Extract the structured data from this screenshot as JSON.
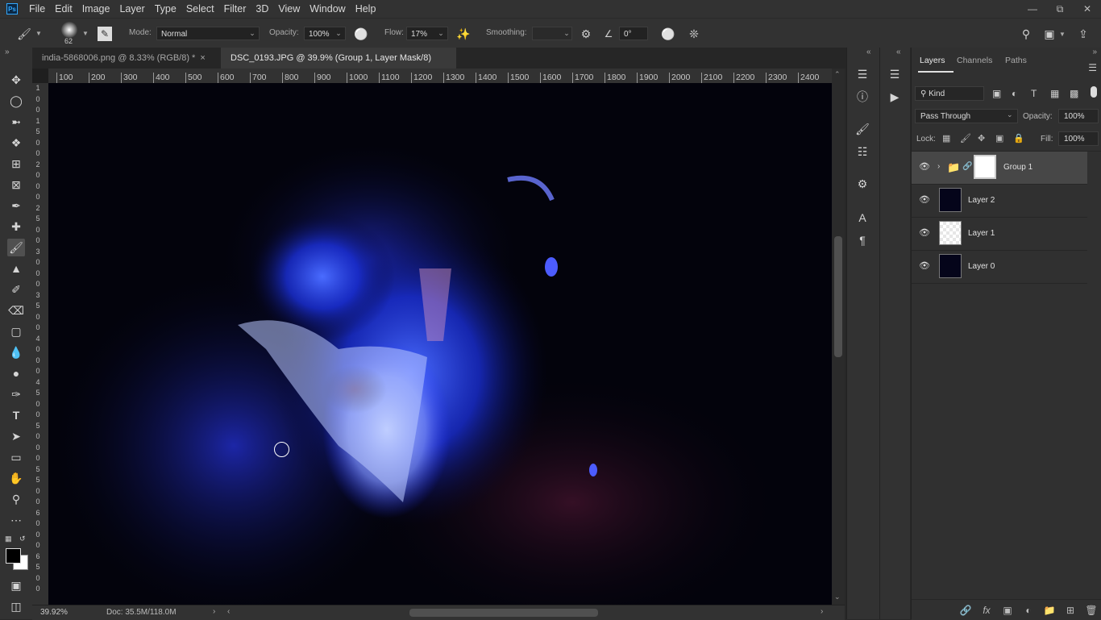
{
  "menubar": {
    "app_icon": "Ps",
    "items": [
      "File",
      "Edit",
      "Image",
      "Layer",
      "Type",
      "Select",
      "Filter",
      "3D",
      "View",
      "Window",
      "Help"
    ]
  },
  "options": {
    "brush_size": "62",
    "mode_label": "Mode:",
    "mode_value": "Normal",
    "opacity_label": "Opacity:",
    "opacity_value": "100%",
    "flow_label": "Flow:",
    "flow_value": "17%",
    "smoothing_label": "Smoothing:",
    "smoothing_value": "",
    "angle_value": "0°"
  },
  "tabs": [
    {
      "label": "india-5868006.png @ 8.33% (RGB/8) *"
    },
    {
      "label": "DSC_0193.JPG @ 39.9% (Group 1, Layer Mask/8) *"
    }
  ],
  "ruler": {
    "h_ticks": [
      "100",
      "200",
      "300",
      "400",
      "500",
      "600",
      "700",
      "800",
      "900",
      "1000",
      "1100",
      "1200",
      "1300",
      "1400",
      "1500",
      "1600",
      "1700",
      "1800",
      "1900",
      "2000",
      "2100",
      "2200",
      "2300",
      "2400"
    ],
    "v_ticks": [
      "1",
      "0",
      "0",
      "1",
      "5",
      "0",
      "0",
      "2",
      "0",
      "0",
      "0",
      "2",
      "5",
      "0",
      "0",
      "3",
      "0",
      "0",
      "0",
      "3",
      "5",
      "0",
      "0",
      "4",
      "0",
      "0",
      "0",
      "4",
      "5",
      "0",
      "0",
      "5",
      "0",
      "0",
      "0",
      "5",
      "5",
      "0",
      "0",
      "6",
      "0",
      "0",
      "0",
      "6",
      "5",
      "0",
      "0"
    ]
  },
  "status": {
    "zoom": "39.92%",
    "doc": "Doc: 35.5M/118.0M"
  },
  "layers_panel": {
    "tabs": [
      "Layers",
      "Channels",
      "Paths"
    ],
    "filter_kind": "Kind",
    "blend_mode": "Pass Through",
    "opacity_label": "Opacity:",
    "opacity_value": "100%",
    "lock_label": "Lock:",
    "fill_label": "Fill:",
    "fill_value": "100%",
    "layers": [
      {
        "name": "Group 1",
        "selected": true
      },
      {
        "name": "Layer 2",
        "selected": false
      },
      {
        "name": "Layer 1",
        "selected": false
      },
      {
        "name": "Layer 0",
        "selected": false
      }
    ]
  },
  "icons": {
    "eye": "eye-icon",
    "brush": "brush-icon",
    "folder": "folder-icon"
  }
}
